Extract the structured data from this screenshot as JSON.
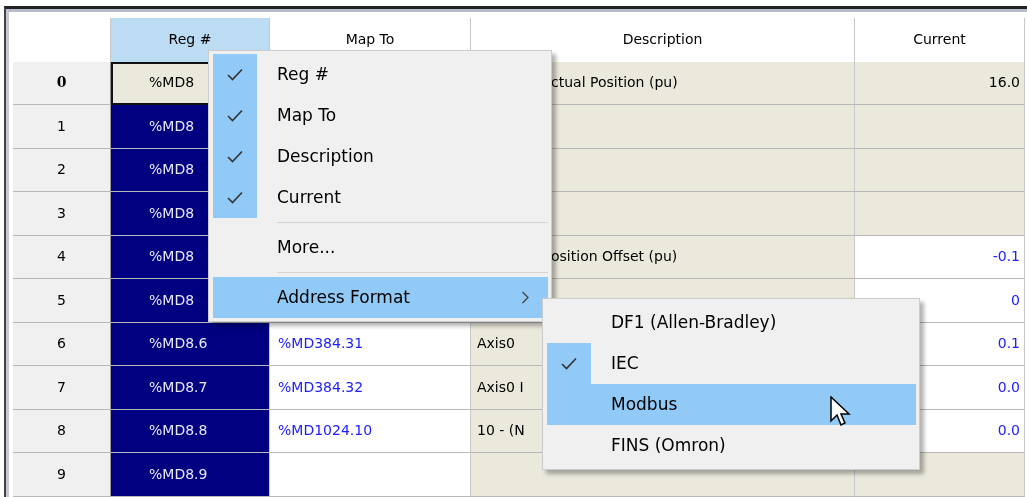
{
  "grid": {
    "columns": [
      {
        "label": "Reg #",
        "selected": true
      },
      {
        "label": "Map To",
        "selected": false
      },
      {
        "label": "Description",
        "selected": false
      },
      {
        "label": "Current",
        "selected": false
      }
    ],
    "rows": [
      {
        "number": "0",
        "selected": false,
        "reg": "%MD8",
        "description": "ctual Position (pu)",
        "current": "16.0",
        "editable": false
      },
      {
        "number": "1",
        "selected": true,
        "reg": "%MD8",
        "editable": false
      },
      {
        "number": "2",
        "selected": true,
        "reg": "%MD8",
        "editable": false
      },
      {
        "number": "3",
        "selected": true,
        "reg": "%MD8",
        "editable": false
      },
      {
        "number": "4",
        "selected": true,
        "reg": "%MD8",
        "description": "osition Offset (pu)",
        "current": "-0.1",
        "editable": true
      },
      {
        "number": "5",
        "selected": true,
        "reg": "%MD8",
        "current": "0",
        "editable": true
      },
      {
        "number": "6",
        "selected": true,
        "reg": "%MD8.6",
        "map_to": "%MD384.31",
        "description": "Axis0",
        "current": "0.1",
        "editable": true
      },
      {
        "number": "7",
        "selected": true,
        "reg": "%MD8.7",
        "map_to": "%MD384.32",
        "description": "Axis0 I",
        "current": "0.0",
        "editable": true
      },
      {
        "number": "8",
        "selected": true,
        "reg": "%MD8.8",
        "map_to": "%MD1024.10",
        "description": "10 - (N",
        "current": "0.0",
        "editable": true
      },
      {
        "number": "9",
        "selected": true,
        "reg": "%MD8.9",
        "editable": false
      }
    ]
  },
  "context_menu": {
    "items": [
      {
        "kind": "item",
        "label": "Reg #",
        "checked": true,
        "selected": false
      },
      {
        "kind": "item",
        "label": "Map To",
        "checked": true,
        "selected": false
      },
      {
        "kind": "item",
        "label": "Description",
        "checked": true,
        "selected": false
      },
      {
        "kind": "item",
        "label": "Current",
        "checked": true,
        "selected": false
      },
      {
        "kind": "separator"
      },
      {
        "kind": "item",
        "label": "More...",
        "checked": false,
        "selected": false
      },
      {
        "kind": "separator"
      },
      {
        "kind": "submenu",
        "label": "Address Format",
        "checked": false,
        "selected": true
      }
    ]
  },
  "submenu": {
    "items": [
      {
        "label": "DF1 (Allen-Bradley)",
        "checked": false,
        "selected": false
      },
      {
        "label": "IEC",
        "checked": true,
        "selected": false
      },
      {
        "label": "Modbus",
        "checked": false,
        "selected": true
      },
      {
        "label": "FINS (Omron)",
        "checked": false,
        "selected": false
      }
    ]
  }
}
